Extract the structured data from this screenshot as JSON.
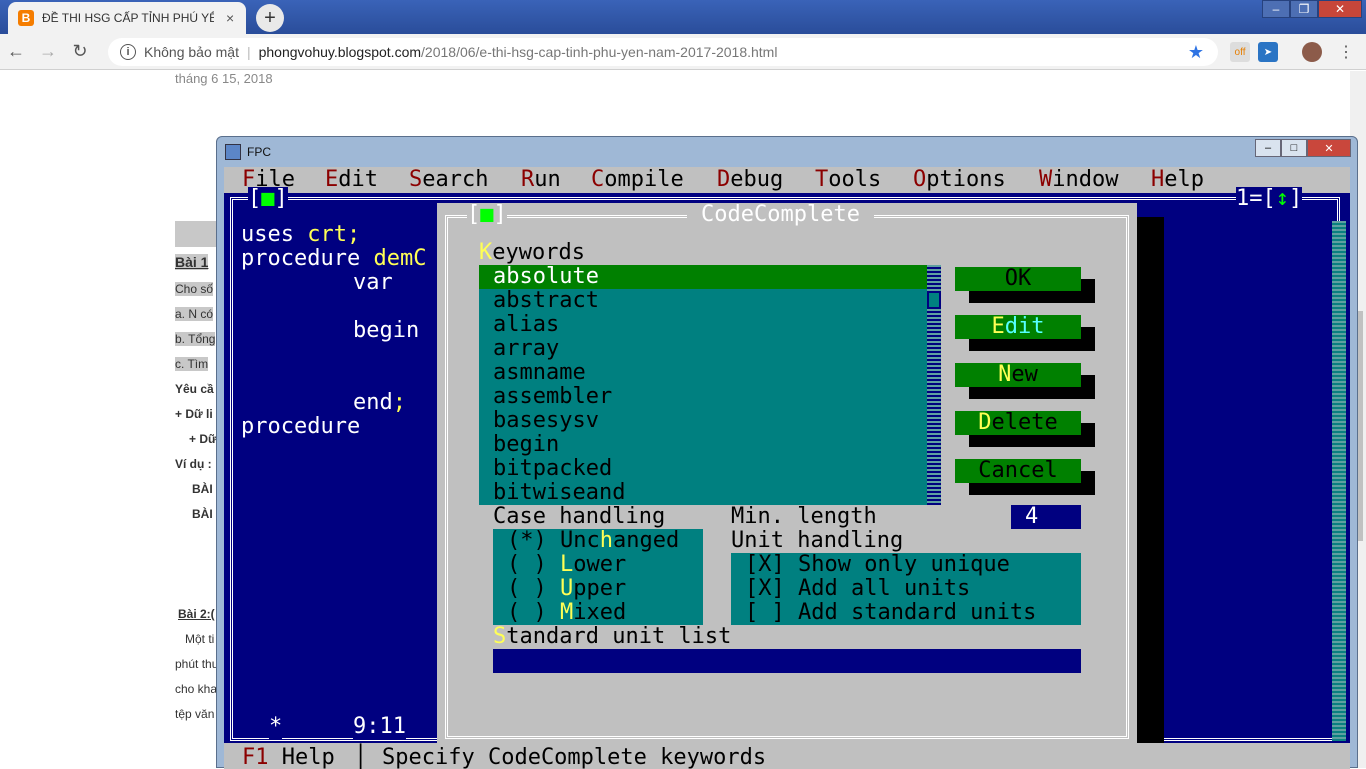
{
  "browser": {
    "tab_title": "ĐỀ THI HSG CẤP TỈNH PHÚ YÊN",
    "tab_close": "×",
    "new_tab": "+",
    "insecure_label": "Không bảo mật",
    "url_host": "phongvohuy.blogspot.com",
    "url_path": "/2018/06/e-thi-hsg-cap-tinh-phu-yen-nam-2017-2018.html",
    "ext1_badge": "off"
  },
  "page": {
    "date": "tháng 6 15, 2018",
    "bai1": "Bài 1",
    "lines": [
      "Cho số",
      "a. N có",
      "b. Tổng",
      "c. Tìm",
      "Yêu cầ",
      "+ Dữ li",
      "+ Dữ",
      "Ví dụ :",
      "BÀI",
      "BÀI"
    ],
    "bai2": "Bài 2:(",
    "lines2": [
      "Một ti",
      "phút thu",
      "cho kha",
      "tệp văn"
    ]
  },
  "fpc": {
    "window_title": "FPC",
    "menu": [
      {
        "hot": "F",
        "rest": "ile"
      },
      {
        "hot": "E",
        "rest": "dit"
      },
      {
        "hot": "S",
        "rest": "earch"
      },
      {
        "hot": "R",
        "rest": "un"
      },
      {
        "hot": "C",
        "rest": "ompile"
      },
      {
        "hot": "D",
        "rest": "ebug"
      },
      {
        "hot": "T",
        "rest": "ools"
      },
      {
        "hot": "O",
        "rest": "ptions"
      },
      {
        "hot": "W",
        "rest": "indow"
      },
      {
        "hot": "H",
        "rest": "elp"
      }
    ],
    "editor": {
      "line1_kw": "uses",
      "line1_rest": "crt;",
      "line2_kw": "procedure",
      "line2_rest": "demC",
      "line3": "var",
      "line4": "begin",
      "line5_kw": "end",
      "line5_rest": ";",
      "line6": "procedure",
      "window_number": "1",
      "cursor_pos": "9:11",
      "modified": "*"
    },
    "dialog": {
      "title": "CodeComplete",
      "keywords_hot": "K",
      "keywords_rest": "eywords",
      "keywords": [
        "absolute",
        "abstract",
        "alias",
        "array",
        "asmname",
        "assembler",
        "basesysv",
        "begin",
        "bitpacked",
        "bitwiseand"
      ],
      "buttons": [
        {
          "hot": "",
          "pre": "",
          "label": "OK"
        },
        {
          "pre": "E",
          "hot": "d",
          "label": "it"
        },
        {
          "pre": "",
          "hot": "N",
          "label": "ew"
        },
        {
          "pre": "",
          "hot": "D",
          "label": "elete"
        },
        {
          "pre": "",
          "hot": "",
          "label": "Cancel"
        }
      ],
      "case_handling_label": "Case handling",
      "case_options": [
        {
          "mark": "(*)",
          "pre": "Unc",
          "hot": "h",
          "rest": "anged"
        },
        {
          "mark": "( )",
          "pre": "",
          "hot": "L",
          "rest": "ower"
        },
        {
          "mark": "( )",
          "pre": "",
          "hot": "U",
          "rest": "pper"
        },
        {
          "mark": "( )",
          "pre": "",
          "hot": "M",
          "rest": "ixed"
        }
      ],
      "min_length_label": "Min. length",
      "min_length_value": "4",
      "unit_handling_label": "Unit handling",
      "unit_options": [
        {
          "mark": "[X]",
          "label": "Show only unique"
        },
        {
          "mark": "[X]",
          "label": "Add all units"
        },
        {
          "mark": "[ ]",
          "label": "Add standard units"
        }
      ],
      "std_unit_hot": "S",
      "std_unit_rest": "tandard unit list",
      "std_unit_value": ""
    },
    "status": {
      "f1": "F1",
      "help": "Help",
      "sep": "│",
      "hint": "Specify CodeComplete keywords"
    }
  }
}
